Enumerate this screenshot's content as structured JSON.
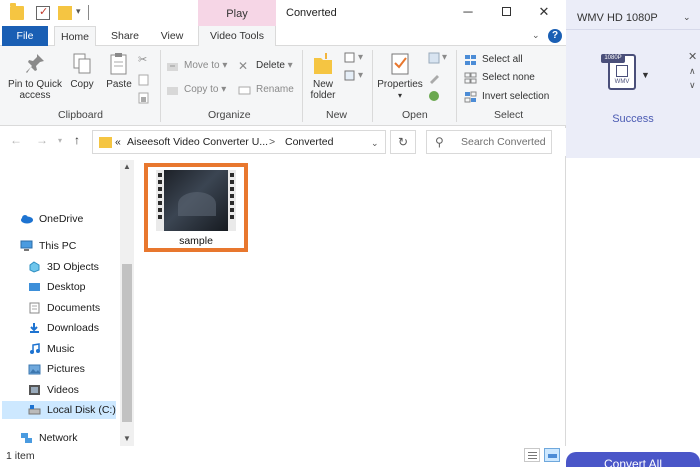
{
  "window": {
    "title": "Converted",
    "contextual_tab": "Play",
    "min_glyph": "─",
    "close_glyph": "✕"
  },
  "ribbon_tabs": {
    "file": "File",
    "home": "Home",
    "share": "Share",
    "view": "View",
    "video_tools": "Video Tools"
  },
  "clipboard": {
    "pin": "Pin to Quick access",
    "copy": "Copy",
    "paste": "Paste",
    "label": "Clipboard"
  },
  "organize": {
    "move_to": "Move to",
    "copy_to": "Copy to",
    "delete": "Delete",
    "rename": "Rename",
    "label": "Organize"
  },
  "new": {
    "new_folder": "New folder",
    "label": "New"
  },
  "open": {
    "properties": "Properties",
    "label": "Open"
  },
  "select": {
    "select_all": "Select all",
    "select_none": "Select none",
    "invert": "Invert selection",
    "label": "Select"
  },
  "address": {
    "prefix": "«",
    "parent": "Aiseesoft Video Converter U...",
    "separator": ">",
    "current": "Converted",
    "search_placeholder": "Search Converted"
  },
  "nav_pane": {
    "items": [
      {
        "label": "OneDrive",
        "icon": "cloud-icon"
      },
      {
        "label": "This PC",
        "icon": "computer-icon"
      },
      {
        "label": "3D Objects",
        "icon": "cube-icon"
      },
      {
        "label": "Desktop",
        "icon": "desktop-icon"
      },
      {
        "label": "Documents",
        "icon": "documents-icon"
      },
      {
        "label": "Downloads",
        "icon": "downloads-icon"
      },
      {
        "label": "Music",
        "icon": "music-icon"
      },
      {
        "label": "Pictures",
        "icon": "pictures-icon"
      },
      {
        "label": "Videos",
        "icon": "videos-icon"
      },
      {
        "label": "Local Disk (C:)",
        "icon": "drive-icon"
      },
      {
        "label": "Network",
        "icon": "network-icon"
      }
    ]
  },
  "files": [
    {
      "name": "sample",
      "icon": "video-thumbnail-icon"
    }
  ],
  "status": {
    "item_count": "1 item"
  },
  "converter": {
    "format": "WMV HD 1080P",
    "badge": "1080P",
    "icon_text": "WMV",
    "status": "Success",
    "convert_button": "Convert All"
  },
  "colors": {
    "file_tab": "#1a5fb4",
    "play_tab": "#f6d6e6",
    "selection_border": "#e8772e",
    "converter_bg": "#ebedf8",
    "success_text": "#4b5bb3",
    "convert_button": "#4a56c8"
  }
}
